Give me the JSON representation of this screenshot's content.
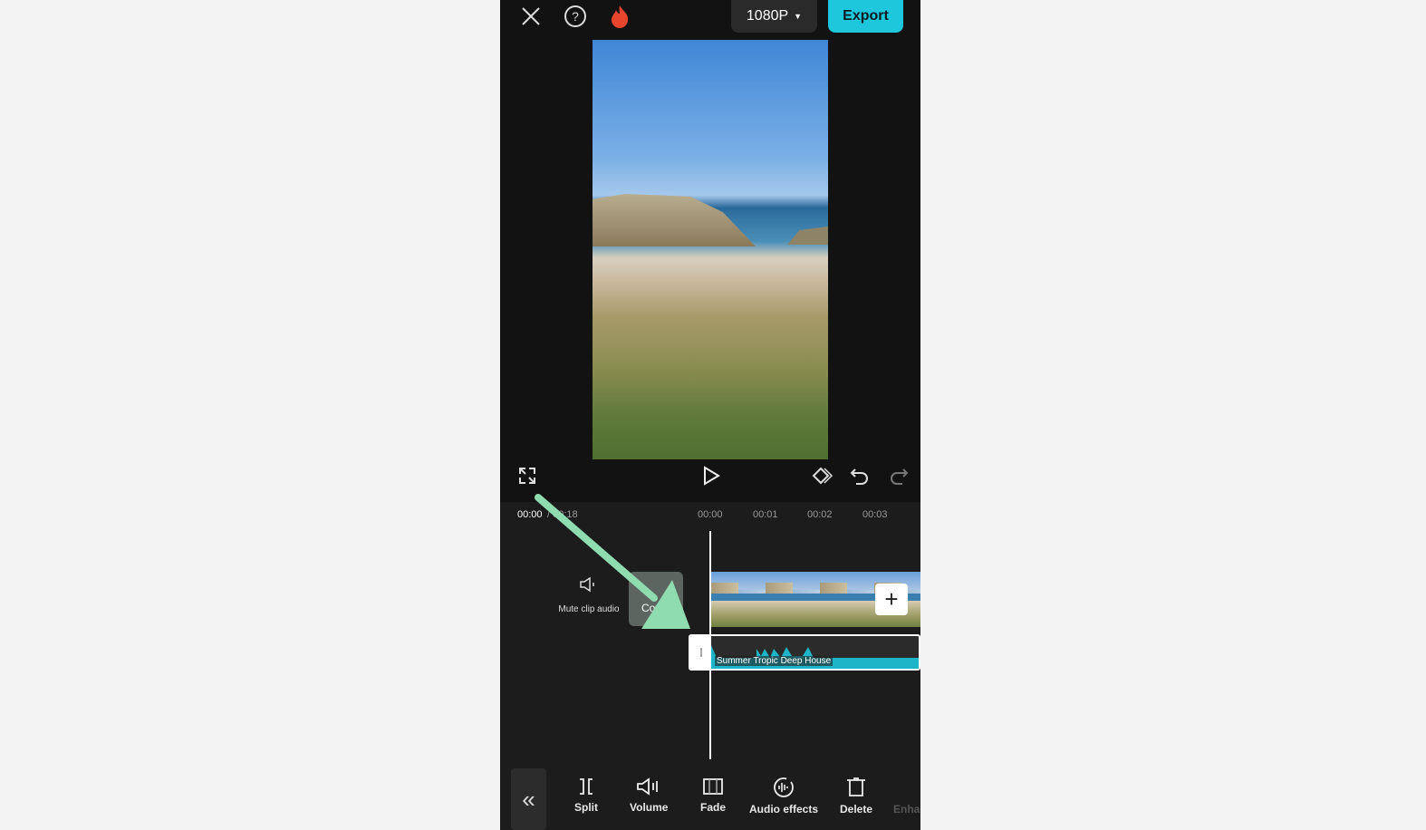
{
  "header": {
    "resolution": "1080P",
    "export_label": "Export"
  },
  "timeline": {
    "current_time": "00:00",
    "total_time": "/ 00:18",
    "ruler": [
      "00:00",
      "00:01",
      "00:02",
      "00:03"
    ],
    "mute_label": "Mute clip audio",
    "cover_label": "Cover",
    "audio_track": "Summer Tropic Deep House"
  },
  "toolbar": {
    "items": [
      {
        "label": "Split",
        "icon": "split-icon"
      },
      {
        "label": "Volume",
        "icon": "volume-icon"
      },
      {
        "label": "Fade",
        "icon": "fade-icon"
      },
      {
        "label": "Audio effects",
        "icon": "audio-effects-icon"
      },
      {
        "label": "Delete",
        "icon": "delete-icon"
      },
      {
        "label": "Enha",
        "icon": "enhance-icon"
      }
    ]
  },
  "colors": {
    "accent": "#1fc7dc",
    "arrow": "#8fdcb0",
    "waveform": "#1fb5c9"
  }
}
